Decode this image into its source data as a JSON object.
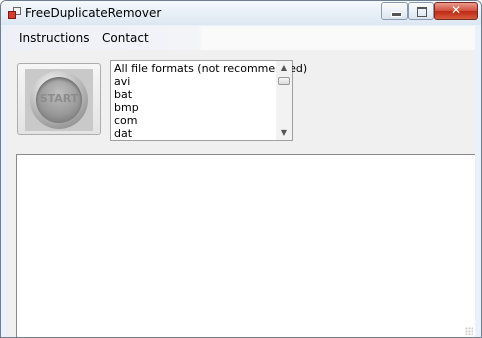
{
  "window": {
    "title": "FreeDuplicateRemover",
    "icon": "app-icon",
    "controls": {
      "minimize_icon": "minimize-icon",
      "maximize_icon": "maximize-icon",
      "close_glyph": "✕"
    }
  },
  "menu": {
    "items": [
      {
        "label": "Instructions"
      },
      {
        "label": "Contact"
      }
    ]
  },
  "start_button": {
    "label": "START"
  },
  "file_types": {
    "items": [
      "All file formats (not recommended)",
      "avi",
      "bat",
      "bmp",
      "com",
      "dat"
    ],
    "scroll_up_glyph": "▲",
    "scroll_down_glyph": "▼"
  },
  "output": {
    "text": ""
  },
  "colors": {
    "titlebar_top": "#f5f9fd",
    "titlebar_bottom": "#dce7f2",
    "close_button": "#c9402b",
    "client_background": "#f0f0f0"
  }
}
